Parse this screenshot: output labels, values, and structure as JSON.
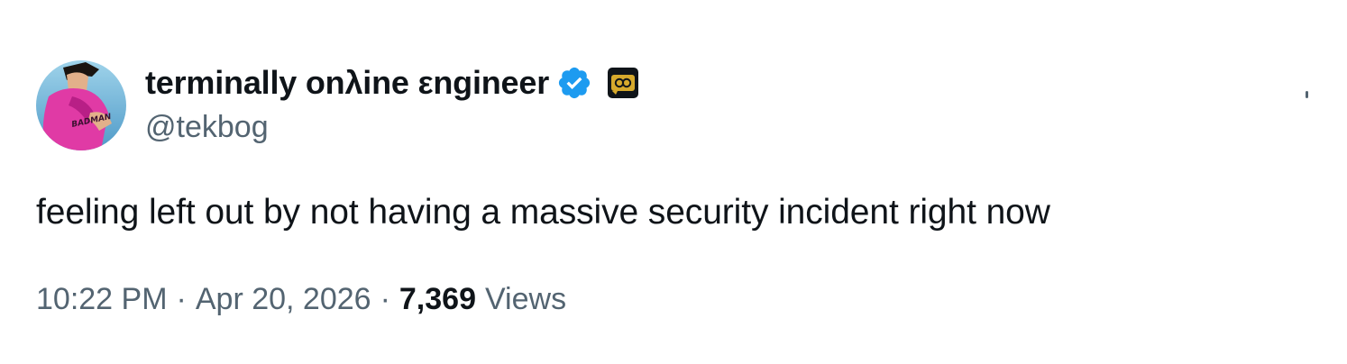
{
  "tweet": {
    "author": {
      "display_name": "terminally onλine εngineer",
      "handle": "@tekbog",
      "avatar_icon": "avatar-image",
      "avatar_text": "BADMAN",
      "verified_icon": "verified-badge-icon",
      "affiliate_icon": "affiliate-badge-icon"
    },
    "text": "feeling left out by not having a massive security incident right now",
    "time": "10:22 PM",
    "separator": "·",
    "date": "Apr 20, 2026",
    "views_count": "7,369",
    "views_label": "Views"
  },
  "colors": {
    "text_primary": "#0f1419",
    "text_secondary": "#536471",
    "verified_blue": "#1d9bf0",
    "background": "#ffffff"
  }
}
